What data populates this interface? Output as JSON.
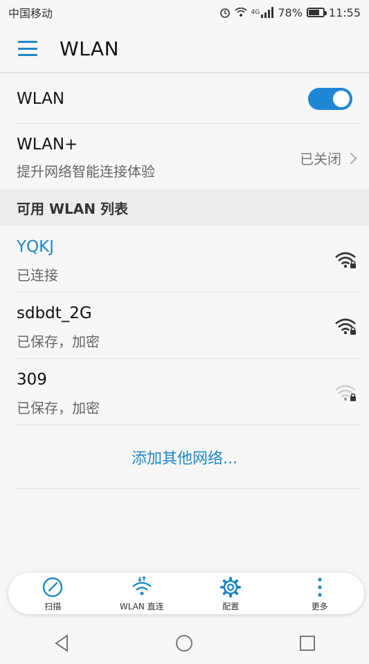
{
  "status_bar": {
    "carrier": "中国移动",
    "network": "4G",
    "battery": "78%",
    "battery_level": 0.78,
    "time": "11:55"
  },
  "app_bar": {
    "title": "WLAN",
    "menu_icon": "menu-icon"
  },
  "wlan_toggle": {
    "label": "WLAN",
    "enabled": true
  },
  "wlan_plus": {
    "title": "WLAN+",
    "subtitle": "提升网络智能连接体验",
    "status": "已关闭"
  },
  "section": {
    "available_header": "可用 WLAN 列表"
  },
  "networks": [
    {
      "name": "YQKJ",
      "status": "已连接",
      "connected": true,
      "signal": "strong"
    },
    {
      "name": "sdbdt_2G",
      "status": "已保存，加密",
      "connected": false,
      "signal": "strong"
    },
    {
      "name": "309",
      "status": "已保存，加密",
      "connected": false,
      "signal": "weak"
    }
  ],
  "add_network": "添加其他网络...",
  "toolbar": {
    "scan": {
      "label": "扫描",
      "icon": "scan-icon"
    },
    "direct": {
      "label": "WLAN 直连",
      "icon": "wifi-direct-icon"
    },
    "config": {
      "label": "配置",
      "icon": "gear-icon"
    },
    "more": {
      "label": "更多",
      "icon": "more-vertical-icon"
    }
  },
  "colors": {
    "accent": "#1f86c8",
    "toggle_on": "#1f86d6",
    "section_bg": "#ececec"
  }
}
